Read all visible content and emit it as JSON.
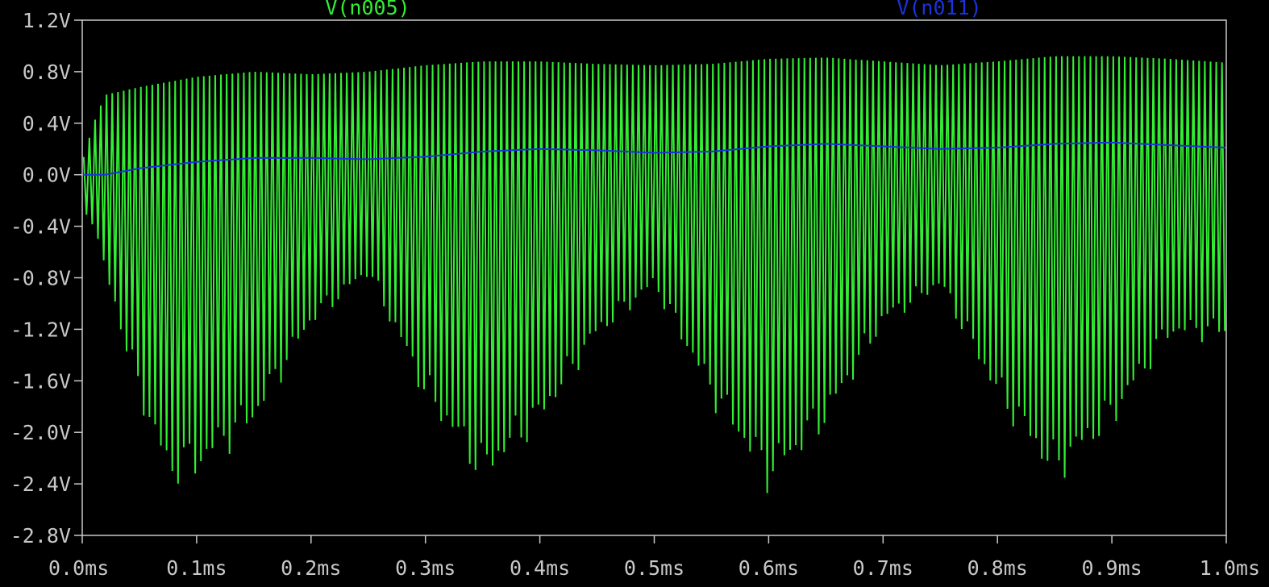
{
  "chart_data": {
    "type": "line",
    "title": "",
    "xlabel": "",
    "ylabel": "",
    "xlim": [
      0.0,
      1.0
    ],
    "ylim": [
      -2.8,
      1.2
    ],
    "x_ticks": [
      "0.0ms",
      "0.1ms",
      "0.2ms",
      "0.3ms",
      "0.4ms",
      "0.5ms",
      "0.6ms",
      "0.7ms",
      "0.8ms",
      "0.9ms",
      "1.0ms"
    ],
    "y_ticks": [
      "1.2V",
      "0.8V",
      "0.4V",
      "0.0V",
      "-0.4V",
      "-0.8V",
      "-1.2V",
      "-1.6V",
      "-2.0V",
      "-2.4V",
      "-2.8V"
    ],
    "x_tick_values": [
      0.0,
      0.1,
      0.2,
      0.3,
      0.4,
      0.5,
      0.6,
      0.7,
      0.8,
      0.9,
      1.0
    ],
    "y_tick_values": [
      1.2,
      0.8,
      0.4,
      0.0,
      -0.4,
      -0.8,
      -1.2,
      -1.6,
      -2.0,
      -2.4,
      -2.8
    ],
    "grid": false,
    "background": "#000000",
    "axis_color": "#c8c8c8",
    "series": [
      {
        "name": "V(n005)",
        "color": "#33ee33",
        "kind": "oscillating-envelope",
        "oscillation_cycles": 200,
        "upper_envelope": {
          "x": [
            0.0,
            0.01,
            0.02,
            0.05,
            0.1,
            0.15,
            0.2,
            0.25,
            0.3,
            0.35,
            0.4,
            0.45,
            0.5,
            0.55,
            0.6,
            0.65,
            0.7,
            0.75,
            0.8,
            0.85,
            0.9,
            0.95,
            1.0
          ],
          "y": [
            0.1,
            0.4,
            0.62,
            0.68,
            0.76,
            0.8,
            0.78,
            0.8,
            0.85,
            0.88,
            0.88,
            0.86,
            0.85,
            0.86,
            0.9,
            0.91,
            0.88,
            0.85,
            0.88,
            0.92,
            0.92,
            0.9,
            0.87
          ]
        },
        "lower_envelope": {
          "x": [
            0.0,
            0.01,
            0.02,
            0.05,
            0.075,
            0.1,
            0.15,
            0.2,
            0.25,
            0.3,
            0.35,
            0.4,
            0.45,
            0.5,
            0.55,
            0.6,
            0.65,
            0.7,
            0.75,
            0.8,
            0.85,
            0.9,
            0.95,
            1.0
          ],
          "y": [
            -0.3,
            -0.4,
            -0.8,
            -1.8,
            -2.45,
            -2.4,
            -2.0,
            -1.2,
            -0.8,
            -1.8,
            -2.45,
            -2.0,
            -1.3,
            -0.9,
            -1.8,
            -2.5,
            -2.0,
            -1.2,
            -0.9,
            -1.8,
            -2.45,
            -2.0,
            -1.3,
            -1.3
          ]
        }
      },
      {
        "name": "V(n011)",
        "color": "#1a33dd",
        "kind": "line",
        "x": [
          0.0,
          0.02,
          0.05,
          0.1,
          0.15,
          0.2,
          0.25,
          0.3,
          0.35,
          0.4,
          0.45,
          0.5,
          0.55,
          0.6,
          0.65,
          0.7,
          0.75,
          0.8,
          0.85,
          0.9,
          0.95,
          1.0
        ],
        "y": [
          0.0,
          0.0,
          0.05,
          0.1,
          0.13,
          0.13,
          0.12,
          0.14,
          0.18,
          0.2,
          0.19,
          0.17,
          0.18,
          0.22,
          0.24,
          0.22,
          0.2,
          0.21,
          0.24,
          0.25,
          0.23,
          0.21
        ]
      }
    ]
  }
}
